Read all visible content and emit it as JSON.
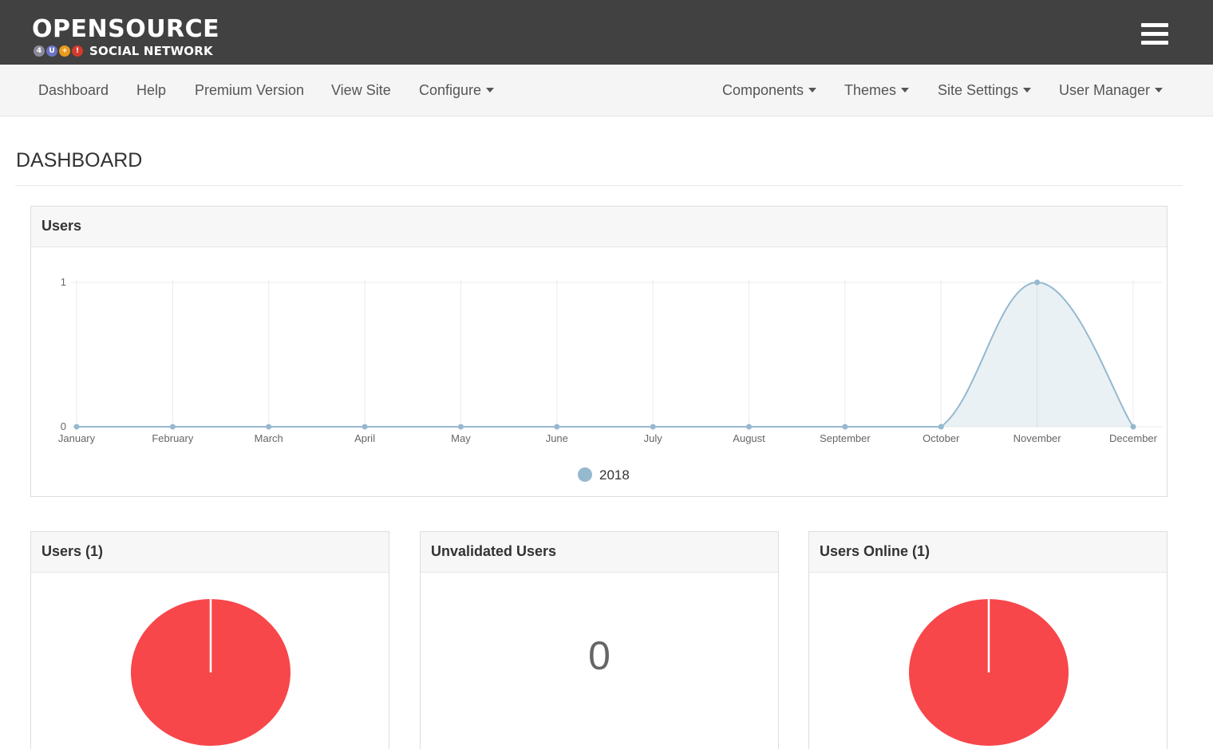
{
  "logo": {
    "main": "OPENSOURCE",
    "sub": "SOCIAL NETWORK",
    "badges": [
      {
        "char": "4",
        "color": "#8a8a9a"
      },
      {
        "char": "U",
        "color": "#6a73c4"
      },
      {
        "char": "+",
        "color": "#e89a1c"
      },
      {
        "char": "!",
        "color": "#d33a2c"
      }
    ]
  },
  "header": {
    "menu_icon": "hamburger-menu-icon"
  },
  "nav": {
    "left": [
      {
        "label": "Dashboard",
        "dropdown": false
      },
      {
        "label": "Help",
        "dropdown": false
      },
      {
        "label": "Premium Version",
        "dropdown": false
      },
      {
        "label": "View Site",
        "dropdown": false
      },
      {
        "label": "Configure",
        "dropdown": true
      }
    ],
    "right": [
      {
        "label": "Components",
        "dropdown": true
      },
      {
        "label": "Themes",
        "dropdown": true
      },
      {
        "label": "Site Settings",
        "dropdown": true
      },
      {
        "label": "User Manager",
        "dropdown": true
      }
    ]
  },
  "page": {
    "title": "DASHBOARD"
  },
  "users_panel": {
    "title": "Users"
  },
  "chart_data": {
    "type": "area",
    "categories": [
      "January",
      "February",
      "March",
      "April",
      "May",
      "June",
      "July",
      "August",
      "September",
      "October",
      "November",
      "December"
    ],
    "series": [
      {
        "name": "2018",
        "values": [
          0,
          0,
          0,
          0,
          0,
          0,
          0,
          0,
          0,
          0,
          1,
          0
        ],
        "color": "#95b9cf"
      }
    ],
    "y_ticks": [
      "0",
      "1"
    ],
    "ylim": [
      0,
      1
    ],
    "grid": true,
    "legend": "bottom"
  },
  "stats": [
    {
      "title": "Users (1)",
      "kind": "pie",
      "slices": [
        {
          "value": 1,
          "color": "#f7474b"
        }
      ]
    },
    {
      "title": "Unvalidated Users",
      "kind": "number",
      "value": "0"
    },
    {
      "title": "Users Online (1)",
      "kind": "pie",
      "slices": [
        {
          "value": 1,
          "color": "#f7474b"
        }
      ]
    }
  ],
  "colors": {
    "topbar": "#414141",
    "navbar": "#f5f5f5",
    "pie": "#f7474b",
    "line": "#95b9cf"
  }
}
